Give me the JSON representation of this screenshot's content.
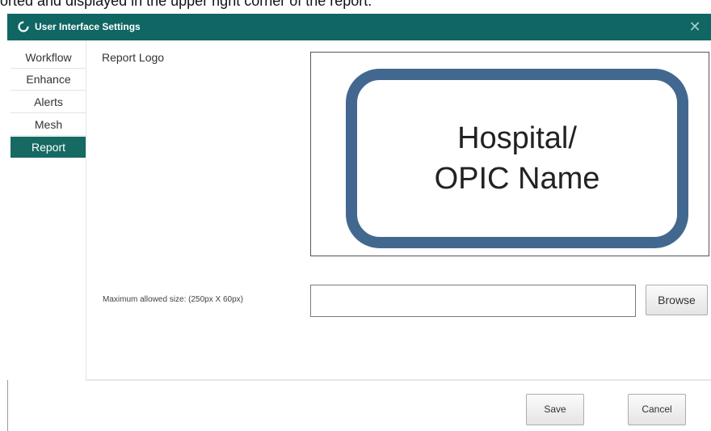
{
  "caption_text": "orted and displayed in the upper right corner of the report.",
  "window": {
    "title": "User Interface Settings",
    "close_symbol": "✕"
  },
  "sidebar": {
    "items": [
      {
        "label": "Workflow"
      },
      {
        "label": "Enhance"
      },
      {
        "label": "Alerts"
      },
      {
        "label": "Mesh"
      },
      {
        "label": "Report"
      }
    ],
    "active": "Report"
  },
  "report": {
    "logo_label": "Report Logo",
    "logo_preview_lines": [
      "Hospital/",
      "OPIC Name"
    ],
    "size_hint": "Maximum allowed size: (250px X 60px)",
    "file_path_value": "",
    "browse_label": "Browse"
  },
  "footer": {
    "save_label": "Save",
    "cancel_label": "Cancel"
  },
  "colors": {
    "titlebar": "#0f6663",
    "active_nav": "#176a63",
    "logo_border": "#42688f"
  },
  "icons": {
    "title_icon": "app-logo-icon",
    "close_icon": "close-icon"
  }
}
